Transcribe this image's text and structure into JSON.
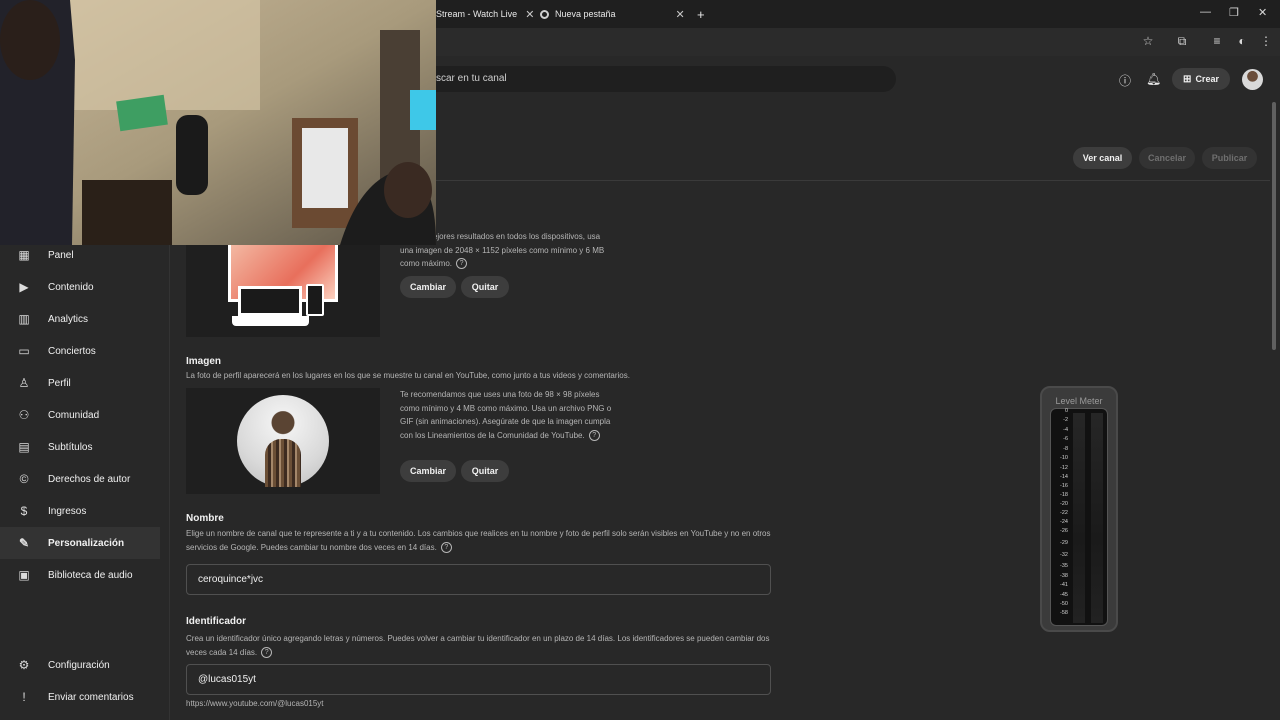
{
  "browser": {
    "tabs": [
      {
        "label": "Stream - Watch Live",
        "close": "✕"
      },
      {
        "label": "Nueva pestaña",
        "close": "✕"
      }
    ],
    "new_tab": "+"
  },
  "header": {
    "search_placeholder": "scar en tu canal",
    "create_label": "Crear"
  },
  "actions": {
    "view_channel": "Ver canal",
    "cancel": "Cancelar",
    "publish": "Publicar"
  },
  "sidebar": {
    "items": [
      {
        "label": "Panel",
        "icon": "dashboard-icon",
        "glyph": "▦"
      },
      {
        "label": "Contenido",
        "icon": "content-icon",
        "glyph": "▶"
      },
      {
        "label": "Analytics",
        "icon": "analytics-icon",
        "glyph": "▥"
      },
      {
        "label": "Conciertos",
        "icon": "concerts-icon",
        "glyph": "▭"
      },
      {
        "label": "Perfil",
        "icon": "profile-icon",
        "glyph": "♙"
      },
      {
        "label": "Comunidad",
        "icon": "community-icon",
        "glyph": "⚇"
      },
      {
        "label": "Subtítulos",
        "icon": "subtitles-icon",
        "glyph": "▤"
      },
      {
        "label": "Derechos de autor",
        "icon": "copyright-icon",
        "glyph": "©"
      },
      {
        "label": "Ingresos",
        "icon": "earn-icon",
        "glyph": "$"
      },
      {
        "label": "Personalización",
        "icon": "customization-icon",
        "glyph": "✎"
      },
      {
        "label": "Biblioteca de audio",
        "icon": "audio-library-icon",
        "glyph": "▣"
      }
    ],
    "bottom": [
      {
        "label": "Configuración",
        "icon": "settings-icon",
        "glyph": "⚙"
      },
      {
        "label": "Enviar comentarios",
        "icon": "feedback-icon",
        "glyph": "!"
      }
    ]
  },
  "banner": {
    "description": "ner los mejores resultados en todos los dispositivos, usa una imagen de 2048 × 1152 píxeles como mínimo y 6 MB como máximo.",
    "change": "Cambiar",
    "remove": "Quitar"
  },
  "picture": {
    "title": "Imagen",
    "subtitle": "La foto de perfil aparecerá en los lugares en los que se muestre tu canal en YouTube, como junto a tus videos y comentarios.",
    "description": "Te recomendamos que uses una foto de 98 × 98 píxeles como mínimo y 4 MB como máximo. Usa un archivo PNG o GIF (sin animaciones). Asegúrate de que la imagen cumpla con los Lineamientos de la Comunidad de YouTube.",
    "change": "Cambiar",
    "remove": "Quitar"
  },
  "name": {
    "title": "Nombre",
    "description": "Elige un nombre de canal que te represente a ti y a tu contenido. Los cambios que realices en tu nombre y foto de perfil solo serán visibles en YouTube y no en otros servicios de Google. Puedes cambiar tu nombre dos veces en 14 días.",
    "value": "ceroquince*jvc"
  },
  "handle": {
    "title": "Identificador",
    "description": "Crea un identificador único agregando letras y números. Puedes volver a cambiar tu identificador en un plazo de 14 días. Los identificadores se pueden cambiar dos veces cada 14 días.",
    "value": "@lucas015yt",
    "url": "https://www.youtube.com/@lucas015yt"
  },
  "level_meter": {
    "title": "Level Meter",
    "ticks": [
      "0",
      "-2",
      "-4",
      "-6",
      "-8",
      "-10",
      "-12",
      "-14",
      "-16",
      "-18",
      "-20",
      "-22",
      "-24",
      "-26",
      "-29",
      "-32",
      "-35",
      "-38",
      "-41",
      "-45",
      "-50",
      "-58"
    ]
  }
}
